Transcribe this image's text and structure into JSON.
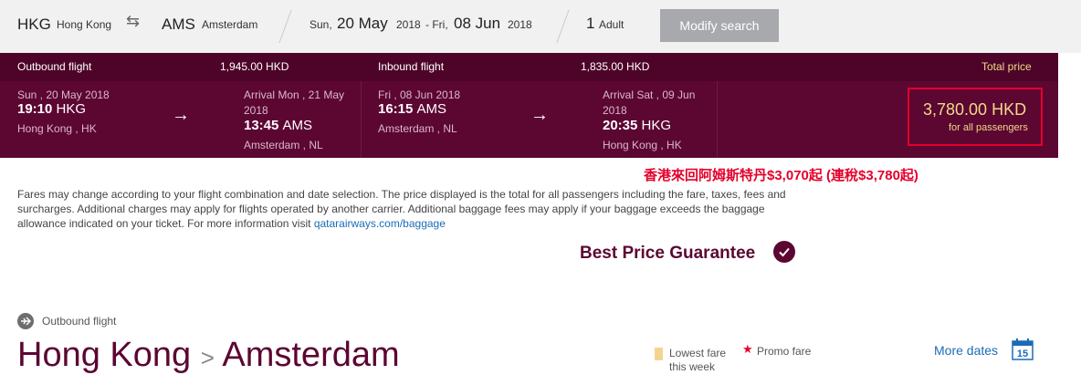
{
  "search": {
    "origin_code": "HKG",
    "origin_city": "Hong Kong",
    "swap_icon": "swap-arrows-icon",
    "dest_code": "AMS",
    "dest_city": "Amsterdam",
    "depart_dow": "Sun,",
    "depart_date": "20 May",
    "depart_year": "2018",
    "date_sep": "- Fri,",
    "return_date": "08 Jun",
    "return_year": "2018",
    "pax_count": "1",
    "pax_label": "Adult",
    "modify_label": "Modify search"
  },
  "summary": {
    "outbound_label": "Outbound flight",
    "outbound_price": "1,945.00 HKD",
    "inbound_label": "Inbound flight",
    "inbound_price": "1,835.00 HKD",
    "total_label": "Total price",
    "outbound": {
      "dep_date": "Sun , 20 May 2018",
      "dep_time": "19:10",
      "dep_code": "HKG",
      "dep_place": "Hong Kong , HK",
      "arr_label_1": "Arrival Mon , 21 May",
      "arr_label_2": "2018",
      "arr_time": "13:45",
      "arr_code": "AMS",
      "arr_place": "Amsterdam , NL"
    },
    "inbound": {
      "dep_date": "Fri , 08 Jun 2018",
      "dep_time": "16:15",
      "dep_code": "AMS",
      "dep_place": "Amsterdam , NL",
      "arr_label_1": "Arrival Sat , 09 Jun",
      "arr_label_2": "2018",
      "arr_time": "20:35",
      "arr_code": "HKG",
      "arr_place": "Hong Kong , HK"
    },
    "total_price": "3,780.00 HKD",
    "total_sub": "for all passengers"
  },
  "annotation": "香港來回阿姆斯特丹$3,070起 (連稅$3,780起)",
  "notice": {
    "text": "Fares may change according to your flight combination and date selection. The price displayed is the total for all passengers including the fare, taxes, fees and surcharges. Additional charges may apply for flights operated by another carrier. Additional baggage fees may apply if your baggage exceeds the baggage allowance indicated on your ticket. For more information visit ",
    "link": "qatarairways.com/baggage"
  },
  "guarantee": "Best Price Guarantee",
  "section": {
    "label": "Outbound flight",
    "from": "Hong Kong",
    "sep": ">",
    "to": "Amsterdam",
    "lowest_label": "Lowest fare this week",
    "promo_label": "Promo fare",
    "more_dates": "More dates",
    "calendar_day": "15"
  },
  "colors": {
    "brand": "#5c0632",
    "gold": "#f0d98a",
    "highlight": "#e4002b",
    "link": "#1b6cb7"
  }
}
